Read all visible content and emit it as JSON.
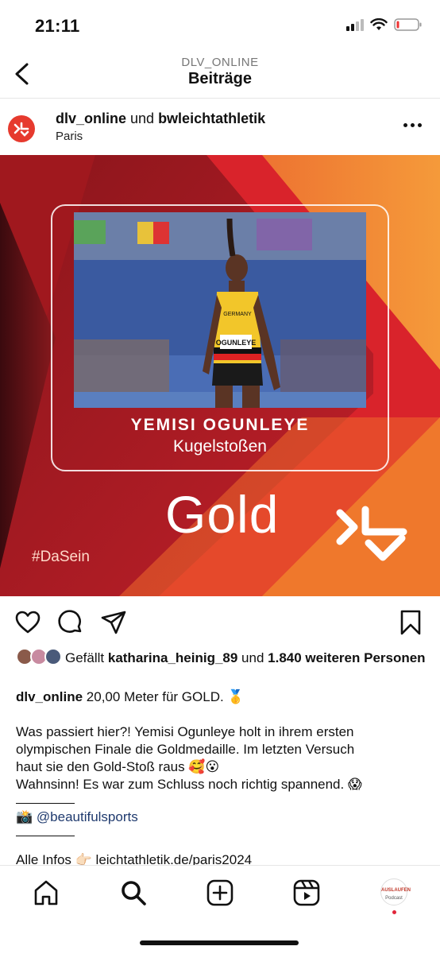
{
  "status": {
    "time": "21:11"
  },
  "nav": {
    "subtitle": "DLV_ONLINE",
    "title": "Beiträge"
  },
  "post": {
    "user1": "dlv_online",
    "connector": " und ",
    "user2": "bwleichtathletik",
    "location": "Paris"
  },
  "image": {
    "name": "YEMISI OGUNLEYE",
    "event": "Kugelstoßen",
    "medal": "Gold",
    "hashtag": "#DaSein",
    "jersey": "OGUNLEYE",
    "country": "GERMANY"
  },
  "likes": {
    "prefix": "Gefällt ",
    "user": "katharina_heinig_89",
    "middle": " und ",
    "count": "1.840 weiteren Personen"
  },
  "caption": {
    "user": "dlv_online",
    "line1": " 20,00 Meter für GOLD. 🥇",
    "para2_line1": "Was passiert hier?! Yemisi Ogunleye holt in ihrem ersten",
    "para2_line2": "olympischen Finale die Goldmedaille. Im letzten Versuch",
    "para2_line3": "haut sie den Gold-Stoß raus 🥰😮",
    "para2_line4": "Wahnsinn! Es war zum Schluss noch richtig spannend. 😱",
    "photo_credit_icon": "📸",
    "photo_credit": "@beautifulsports",
    "more_line": "Alle Infos 👉🏻 leichtathletik.de/paris2024"
  },
  "profile_tab": {
    "line1": "AUSLAUFEN",
    "line2": "Podcast"
  },
  "colors": {
    "brand_red": "#d8232a",
    "orange": "#f07b2a",
    "dark_red": "#5a0f14"
  }
}
